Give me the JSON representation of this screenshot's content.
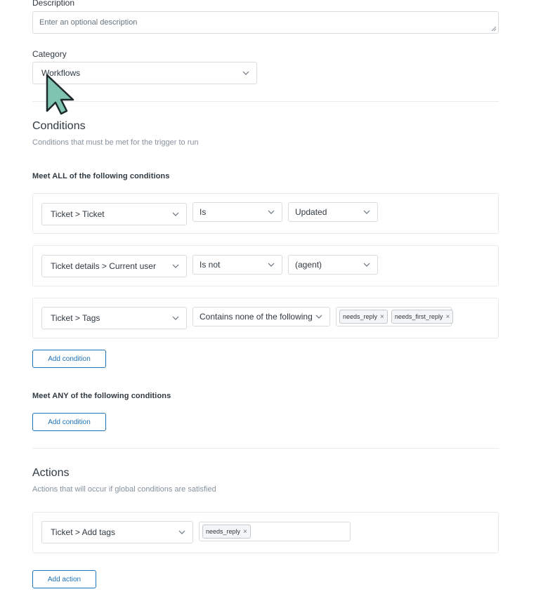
{
  "description": {
    "label": "Description",
    "placeholder": "Enter an optional description"
  },
  "category": {
    "label": "Category",
    "value": "Workflows"
  },
  "conditions": {
    "title": "Conditions",
    "subtitle": "Conditions that must be met for the trigger to run",
    "all_label": "Meet ALL of the following conditions",
    "all": [
      {
        "field": "Ticket > Ticket",
        "operator": "Is",
        "value": "Updated"
      },
      {
        "field": "Ticket details > Current user",
        "operator": "Is not",
        "value": "(agent)"
      },
      {
        "field": "Ticket > Tags",
        "operator": "Contains none of the following",
        "tags": [
          "needs_reply",
          "needs_first_reply"
        ]
      }
    ],
    "add_condition_label": "Add condition",
    "any_label": "Meet ANY of the following conditions",
    "add_any_condition_label": "Add condition"
  },
  "actions": {
    "title": "Actions",
    "subtitle": "Actions that will occur if global conditions are satisfied",
    "items": [
      {
        "field": "Ticket > Add tags",
        "tags": [
          "needs_reply"
        ]
      }
    ],
    "add_action_label": "Add action"
  },
  "colors": {
    "accent": "#1f73b7",
    "cursor": "#7ec4b0"
  }
}
